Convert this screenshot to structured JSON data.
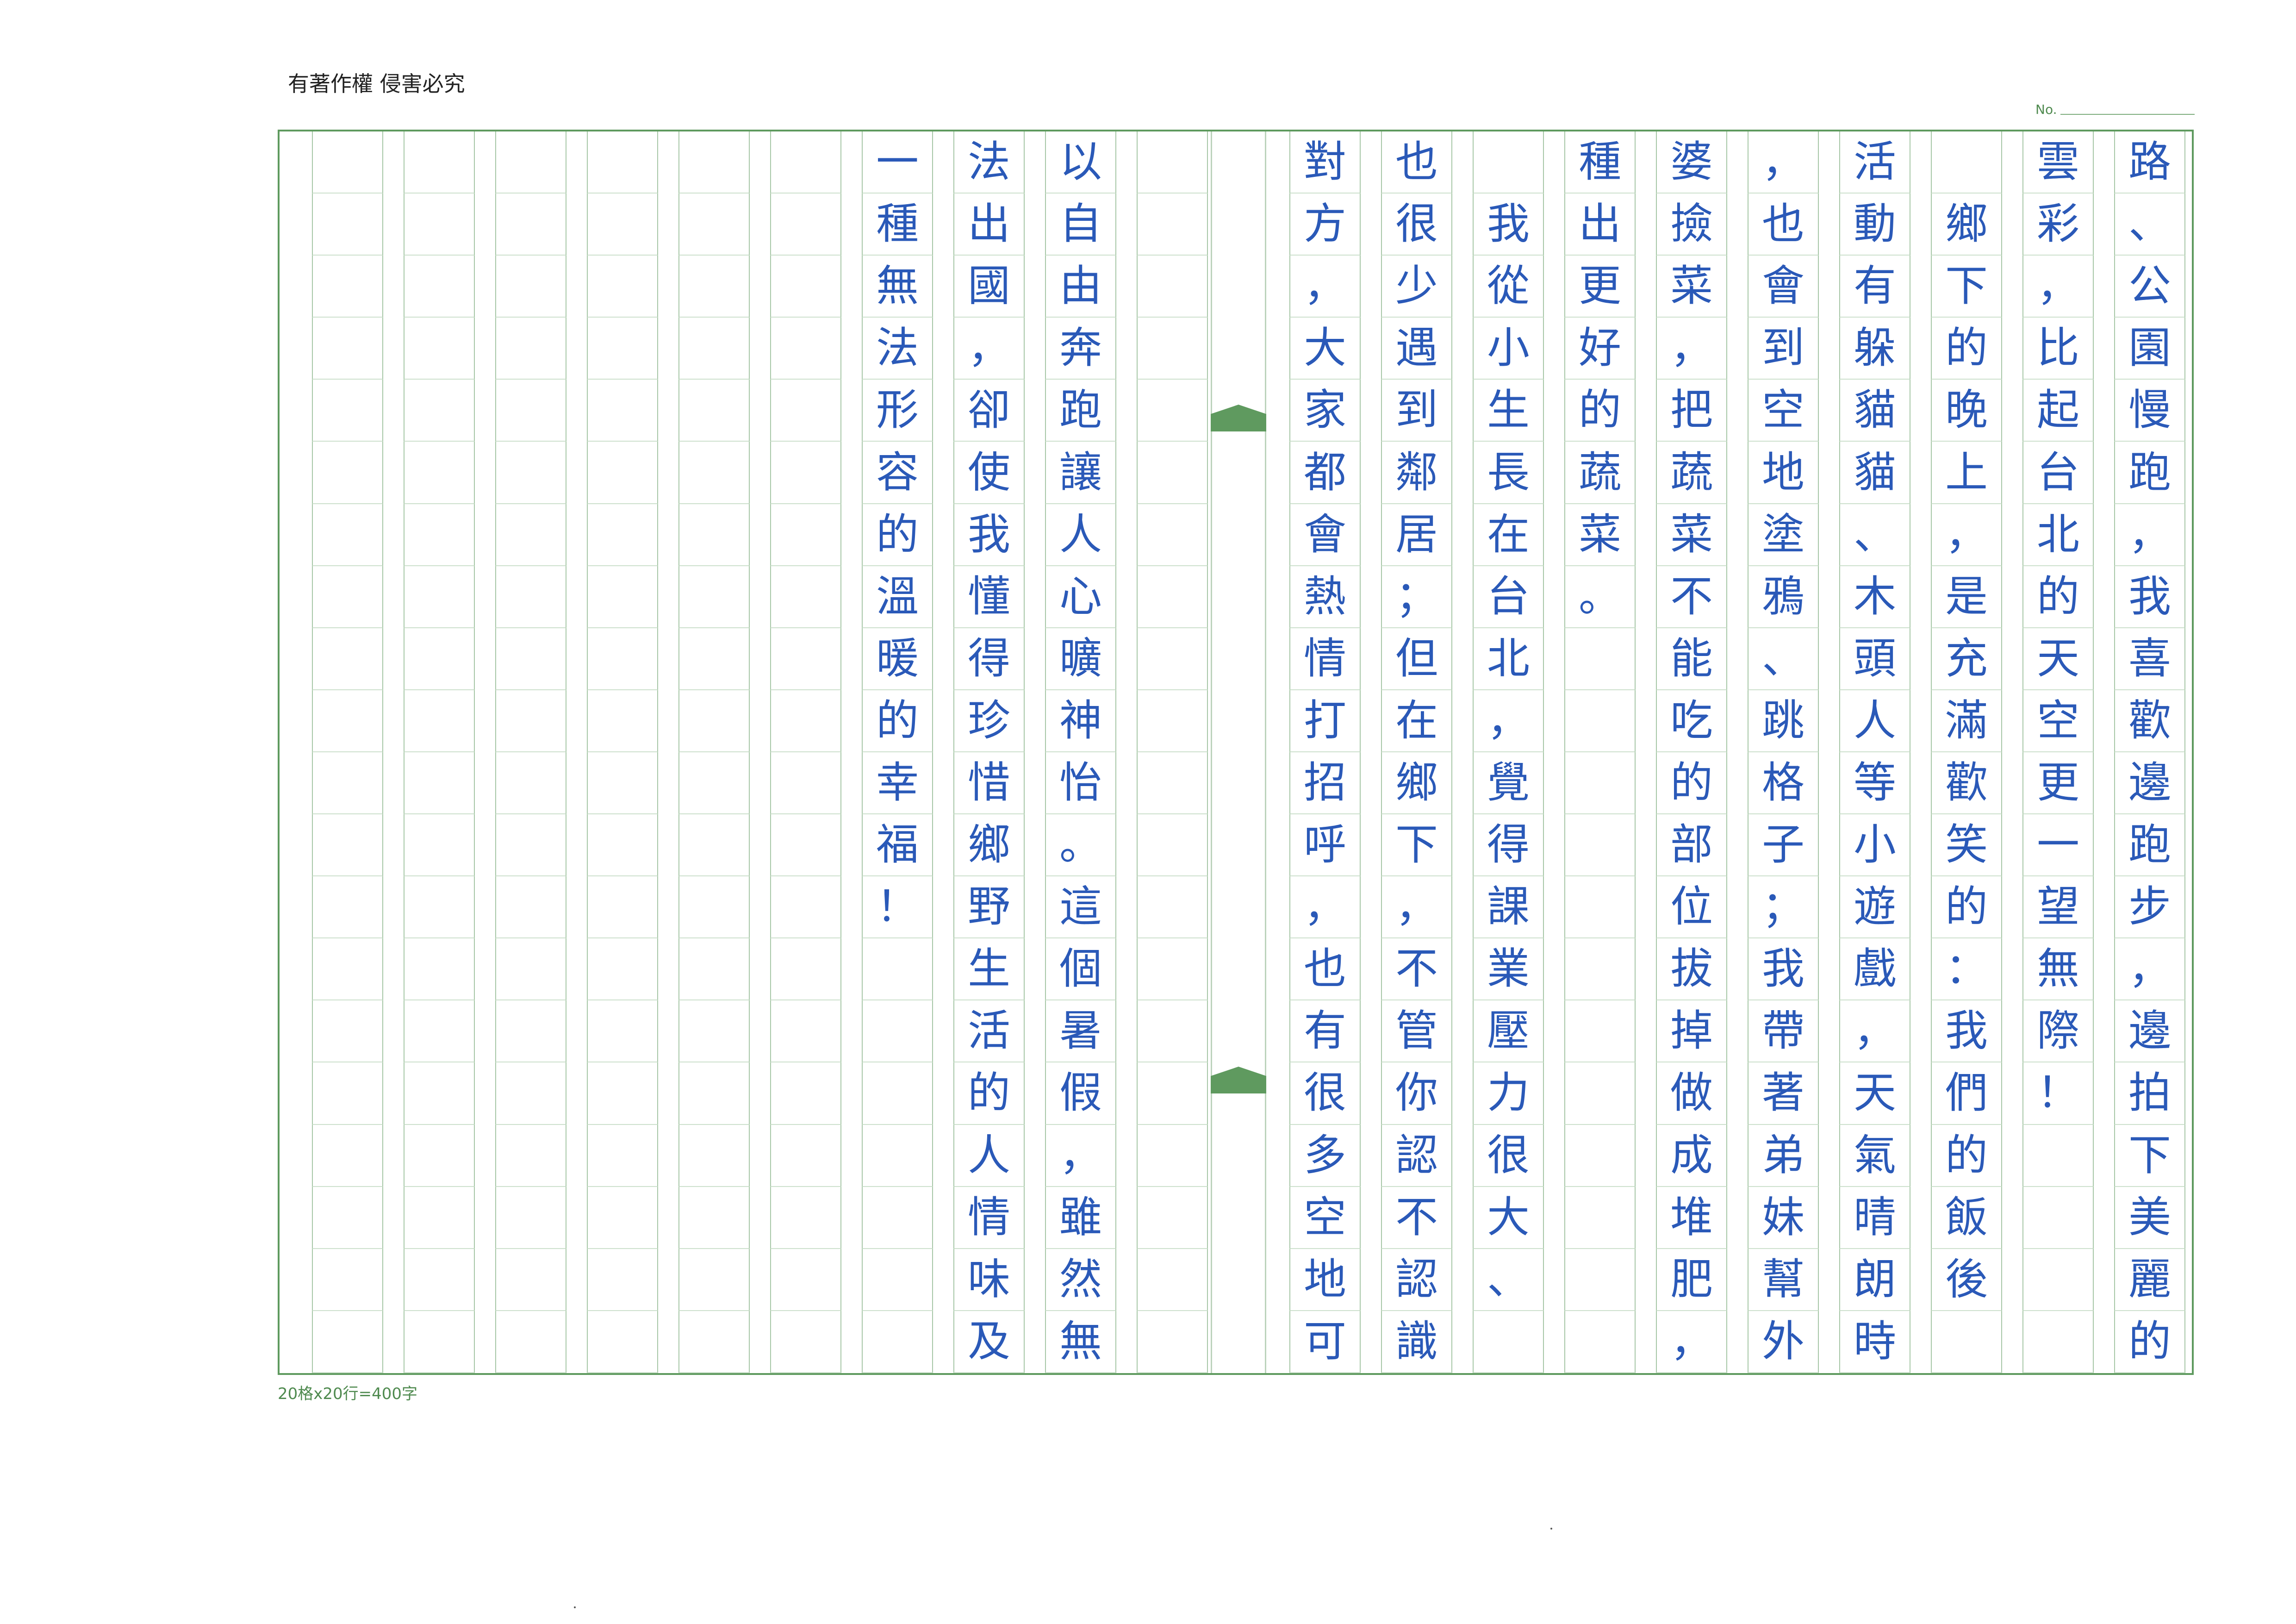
{
  "header": {
    "copyright_notice": "有著作權 侵害必究",
    "number_label": "No."
  },
  "footer": {
    "grid_spec": "20格x20行=400字"
  },
  "manuscript": {
    "rows_per_column": 20,
    "columns_right_to_left": [
      "路、公園慢跑，我喜歡邊跑步，邊拍下美麗的",
      "雲彩，比起台北的天空更一望無際！",
      "　鄉下的晚上，是充滿歡笑的：我們的飯後",
      "活動有躲貓貓、木頭人等小遊戲，天氣晴朗時",
      "，也會到空地塗鴉、跳格子；我帶著弟妹幫外",
      "婆撿菜，把蔬菜不能吃的部位拔掉做成堆肥，",
      "種出更好的蔬菜。",
      "　我從小生長在台北，覺得課業壓力很大、",
      "也很少遇到鄰居；但在鄉下，不管你認不認識",
      "對方，大家都會熱情打招呼，也有很多空地可",
      "",
      "以自由奔跑讓人心曠神怡。這個暑假，雖然無",
      "法出國，卻使我懂得珍惜鄉野生活的人情味及",
      "一種無法形容的溫暖的幸福！",
      "",
      "",
      "",
      "",
      "",
      ""
    ]
  }
}
